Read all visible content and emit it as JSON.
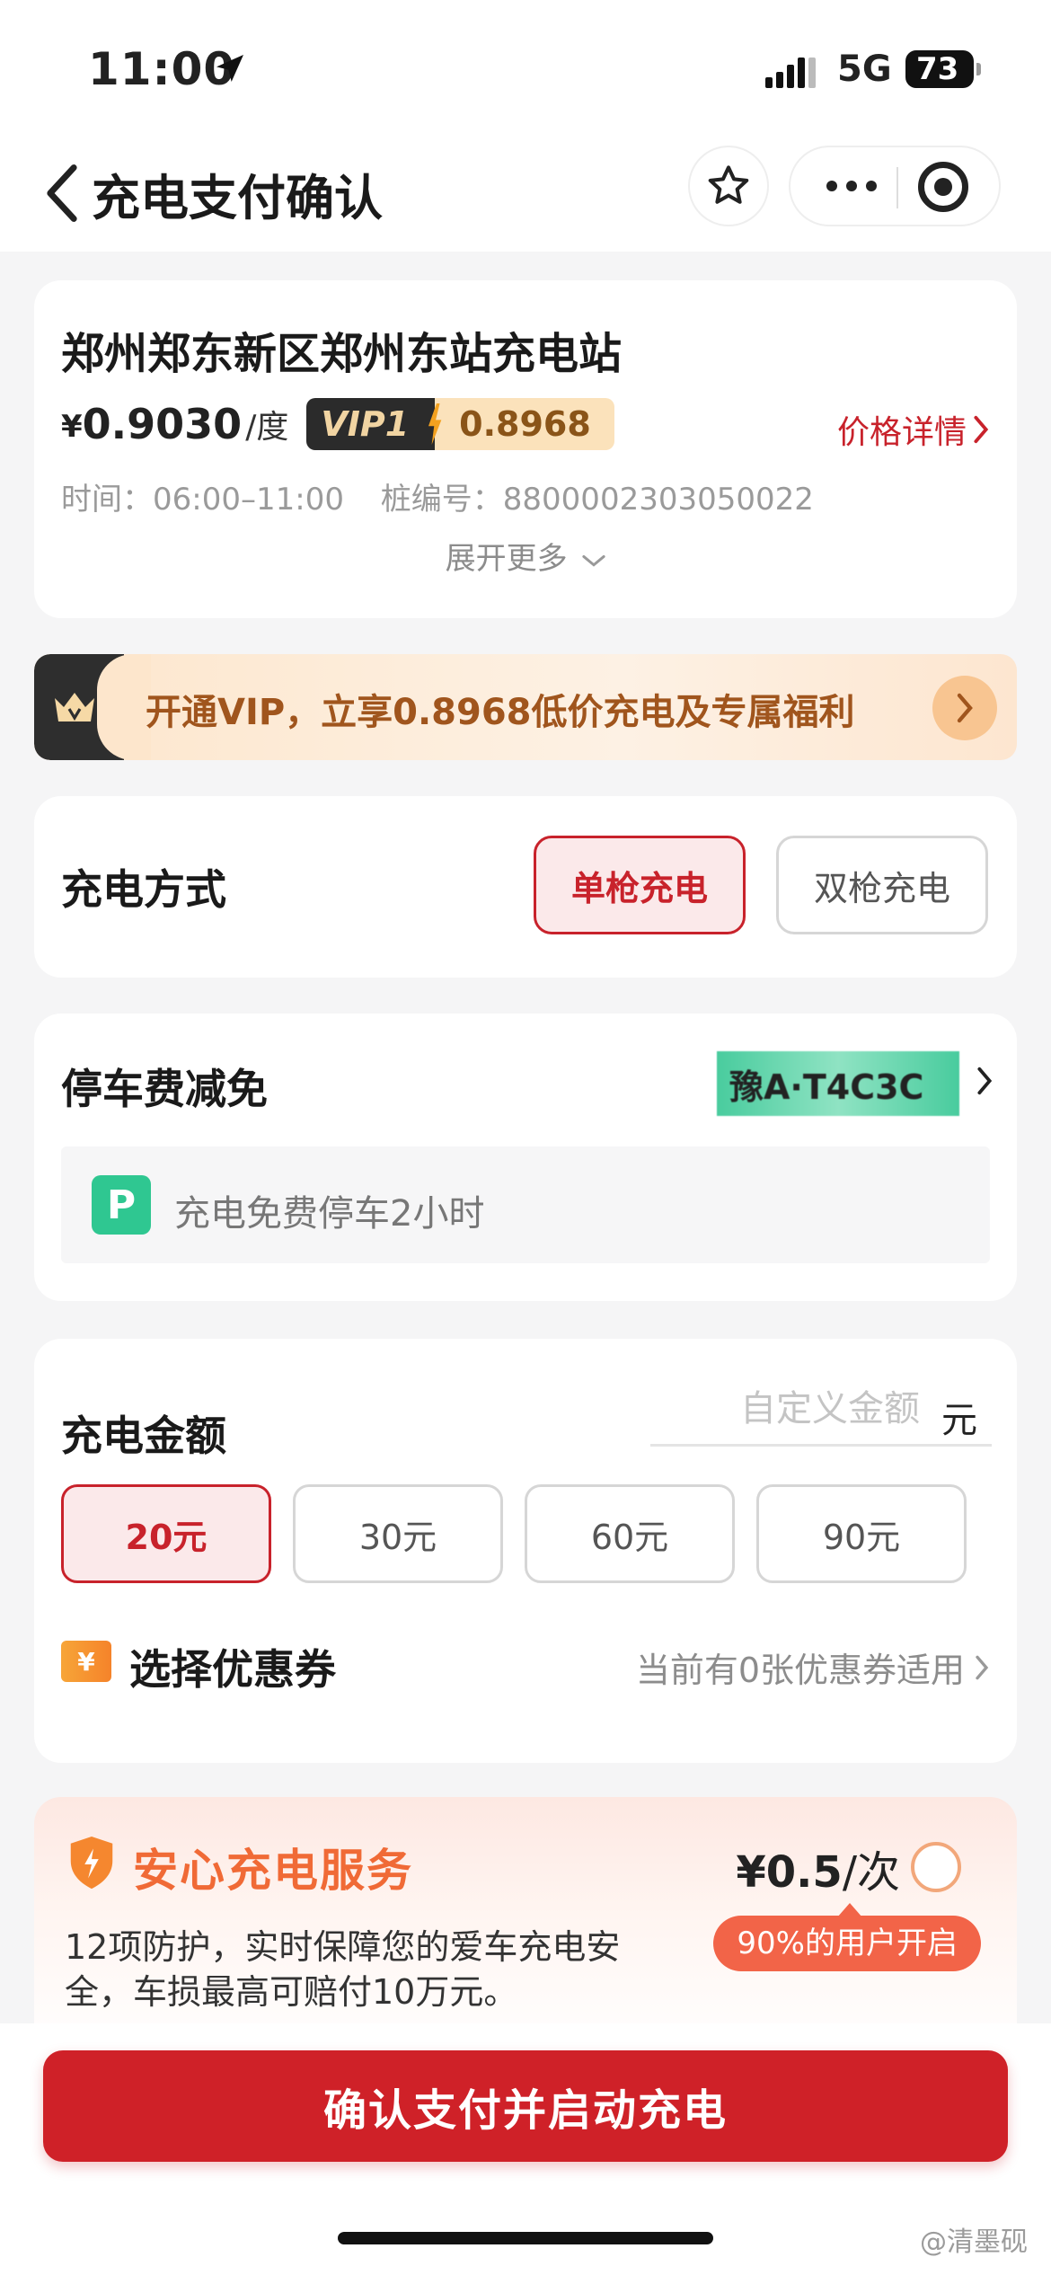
{
  "status_bar": {
    "time": "11:00",
    "network": "5G",
    "battery": "73"
  },
  "nav": {
    "title": "充电支付确认"
  },
  "station": {
    "name": "郑州郑东新区郑州东站充电站",
    "price_currency": "¥",
    "price_value": "0.9030",
    "price_unit": "/度",
    "vip_label": "VIP1",
    "vip_price": "0.8968",
    "price_detail_link": "价格详情",
    "time_label": "时间：06:00–11:00",
    "pile_label": "桩编号：8800002303050022",
    "expand_more": "展开更多"
  },
  "vip_banner": {
    "text": "开通VIP，立享0.8968低价充电及专属福利"
  },
  "charge_mode": {
    "title": "充电方式",
    "options": [
      {
        "label": "单枪充电",
        "selected": true
      },
      {
        "label": "双枪充电",
        "selected": false
      }
    ]
  },
  "parking": {
    "title": "停车费减免",
    "plate": "豫A·T4C3C",
    "badge_letter": "P",
    "benefit": "充电免费停车2小时"
  },
  "amount": {
    "title": "充电金额",
    "custom_placeholder": "自定义金额",
    "unit": "元",
    "options": [
      {
        "label": "20元",
        "selected": true
      },
      {
        "label": "30元",
        "selected": false
      },
      {
        "label": "60元",
        "selected": false
      },
      {
        "label": "90元",
        "selected": false
      }
    ],
    "coupon_icon_text": "¥",
    "coupon_label": "选择优惠券",
    "coupon_hint": "当前有0张优惠券适用"
  },
  "service": {
    "title": "安心充电服务",
    "price": "¥0.5",
    "price_unit": "/次",
    "description": "12项防护，实时保障您的爱车充电安全，车损最高可赔付10万元。",
    "badge": "90%的用户开启",
    "selected": false
  },
  "confirm_button": "确认支付并启动充电",
  "watermark": "@清墨砚",
  "colors": {
    "brand_red": "#c8222b",
    "vip_gold": "#a0551d",
    "parking_green": "#2fc791",
    "service_orange": "#f06a36"
  }
}
